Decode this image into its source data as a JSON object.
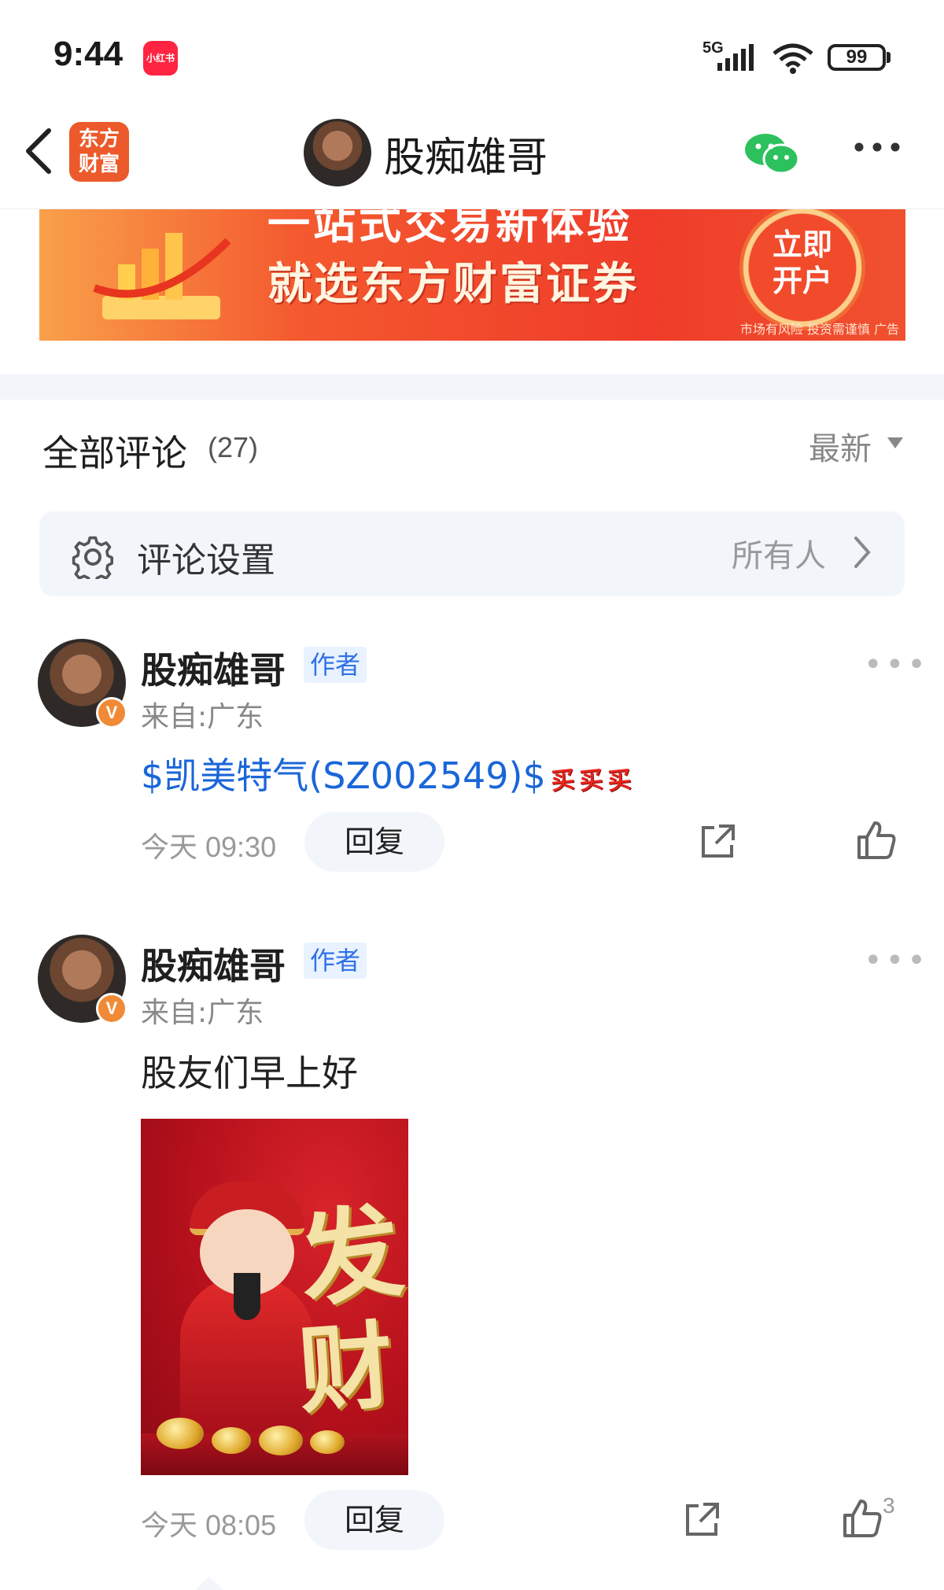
{
  "status_bar": {
    "time": "9:44",
    "app_badge": "小红书",
    "network": "5G",
    "battery": "99"
  },
  "header": {
    "logo_line1": "东方",
    "logo_line2": "财富",
    "title": "股痴雄哥"
  },
  "banner": {
    "headline_top": "一站式交易新体验",
    "headline_main": "就选东方财富证券",
    "cta_line1": "立即",
    "cta_line2": "开户",
    "risk": "市场有风险 投资需谨慎 广告"
  },
  "comments_section": {
    "title": "全部评论",
    "count": "(27)",
    "sort": "最新"
  },
  "settings": {
    "label": "评论设置",
    "value": "所有人"
  },
  "comments": [
    {
      "name": "股痴雄哥",
      "tag": "作者",
      "location": "来自:广东",
      "text": "$凯美特气(SZ002549)$",
      "emojis": [
        "买",
        "买",
        "买"
      ],
      "time": "今天 09:30",
      "reply": "回复",
      "likes": ""
    },
    {
      "name": "股痴雄哥",
      "tag": "作者",
      "location": "来自:广东",
      "text": "股友们早上好",
      "image_chars": [
        "发",
        "财"
      ],
      "time": "今天 08:05",
      "reply": "回复",
      "likes": "3"
    }
  ],
  "badge_letter": "V"
}
